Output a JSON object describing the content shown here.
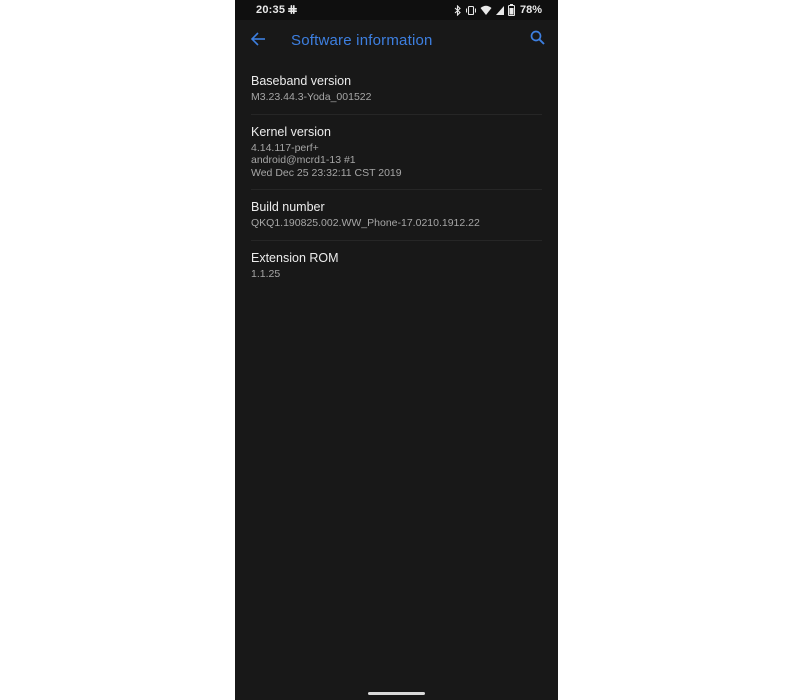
{
  "status_bar": {
    "time": "20:35",
    "battery_percent": "78%",
    "icons": [
      "slack-icon",
      "bluetooth-icon",
      "vibrate-icon",
      "wifi-icon",
      "cell-signal-icon",
      "battery-icon"
    ]
  },
  "toolbar": {
    "title": "Software information",
    "back_icon": "arrow-left-icon",
    "search_icon": "search-icon"
  },
  "items": [
    {
      "title": "Baseband version",
      "lines": [
        "M3.23.44.3-Yoda_001522"
      ]
    },
    {
      "title": "Kernel version",
      "lines": [
        "4.14.117-perf+",
        "android@mcrd1-13 #1",
        "Wed Dec 25 23:32:11 CST 2019"
      ]
    },
    {
      "title": "Build number",
      "lines": [
        "QKQ1.190825.002.WW_Phone-17.0210.1912.22"
      ]
    },
    {
      "title": "Extension ROM",
      "lines": [
        "1.1.25"
      ]
    }
  ],
  "colors": {
    "accent": "#3d7fe0",
    "background": "#181818",
    "status_bar": "#0f0f0f"
  }
}
